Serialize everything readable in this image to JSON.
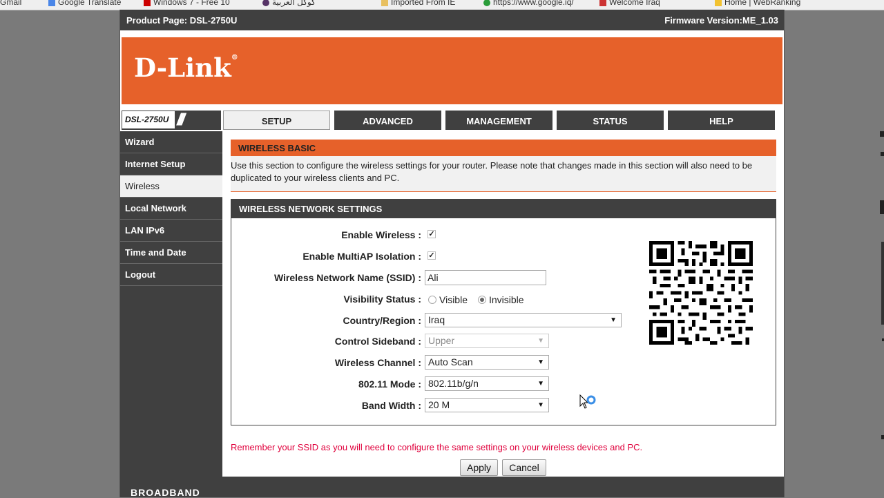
{
  "bookmarks": [
    "Gmail",
    "Google Translate",
    "Windows 7 - Free 10",
    "كوكل العربية",
    "Imported From IE",
    "https://www.google.iq/",
    "Welcome Iraq",
    "Home | WebRanking"
  ],
  "header": {
    "product": "Product Page: DSL-2750U",
    "firmware": "Firmware Version:ME_1.03"
  },
  "logo": "D-Link",
  "model": "DSL-2750U",
  "tabs": [
    "SETUP",
    "ADVANCED",
    "MANAGEMENT",
    "STATUS",
    "HELP"
  ],
  "sidebar": [
    "Wizard",
    "Internet Setup",
    "Wireless",
    "Local Network",
    "LAN IPv6",
    "Time and Date",
    "Logout"
  ],
  "section": {
    "title": "WIRELESS BASIC",
    "description": "Use this section to configure the wireless settings for your router. Please note that changes made in this section will also need to be duplicated to your wireless clients and PC."
  },
  "settings": {
    "title": "WIRELESS NETWORK SETTINGS",
    "enable_wireless_label": "Enable Wireless :",
    "enable_wireless_checked": true,
    "multiap_label": "Enable MultiAP Isolation :",
    "multiap_checked": true,
    "ssid_label": "Wireless Network Name (SSID) :",
    "ssid_value": "Ali",
    "visibility_label": "Visibility Status :",
    "visibility_visible": "Visible",
    "visibility_invisible": "Invisible",
    "visibility_selected": "Invisible",
    "country_label": "Country/Region :",
    "country_value": "Iraq",
    "sideband_label": "Control Sideband :",
    "sideband_value": "Upper",
    "channel_label": "Wireless Channel :",
    "channel_value": "Auto Scan",
    "mode_label": "802.11 Mode :",
    "mode_value": "802.11b/g/n",
    "bandwidth_label": "Band Width :",
    "bandwidth_value": "20 M"
  },
  "note": "Remember your SSID as you will need to configure the same settings on your wireless devices and PC.",
  "buttons": {
    "apply": "Apply",
    "cancel": "Cancel"
  },
  "footer": "BROADBAND",
  "colors": {
    "orange": "#e6612a",
    "dark": "#404040",
    "note_red": "#e0003c"
  }
}
